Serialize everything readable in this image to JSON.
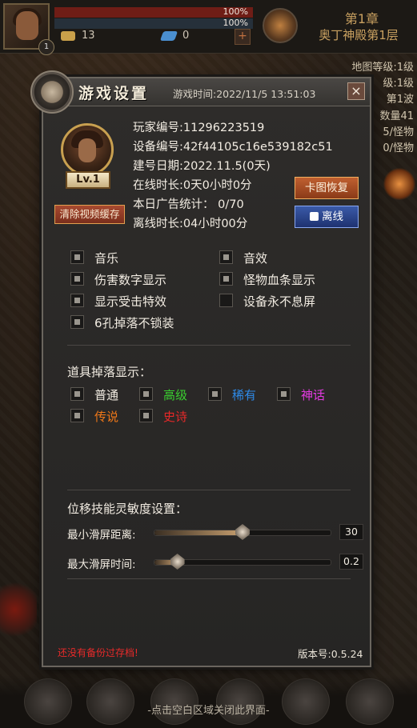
{
  "hud": {
    "hp_percent": "100%",
    "mp_percent": "100%",
    "gold": "13",
    "gems": "0",
    "player_level_badge": "1",
    "chapter": "第1章",
    "stage": "奥丁神殿第1层",
    "side_info": [
      "地图等级:1级",
      "级:1级",
      "第1波",
      "数量41",
      "5/怪物",
      "0/怪物"
    ],
    "close_hint": "-点击空白区域关闭此界面-"
  },
  "dialog": {
    "title": "游戏设置",
    "game_time": "游戏时间:2022/11/5 13:51:03",
    "close_icon": "×",
    "avatar_level": "Lv.1",
    "clear_cache_button": "清除视频缓存",
    "info": {
      "player_id": "玩家编号:11296223519",
      "device_id": "设备编号:42f44105c16e539182c51",
      "created": "建号日期:2022.11.5(0天)",
      "online_time": "在线时长:0天0小时0分",
      "ad_stats": "本日广告统计： 0/70",
      "offline_time": "离线时长:04小时00分"
    },
    "restore_button": "卡图恢复",
    "offline_button": "离线",
    "options": [
      {
        "label": "音乐",
        "checked": true
      },
      {
        "label": "音效",
        "checked": true
      },
      {
        "label": "伤害数字显示",
        "checked": true
      },
      {
        "label": "怪物血条显示",
        "checked": true
      },
      {
        "label": "显示受击特效",
        "checked": true
      },
      {
        "label": "设备永不息屏",
        "checked": false
      },
      {
        "label": "6孔掉落不锁装",
        "checked": true
      }
    ],
    "drop_section_title": "道具掉落显示：",
    "drop_filters": [
      {
        "label": "普通",
        "checked": true,
        "color": "#f2ece2"
      },
      {
        "label": "高级",
        "checked": true,
        "color": "#3ad030"
      },
      {
        "label": "稀有",
        "checked": true,
        "color": "#2e8ae8"
      },
      {
        "label": "神话",
        "checked": true,
        "color": "#e23ae0"
      },
      {
        "label": "传说",
        "checked": true,
        "color": "#f07818"
      },
      {
        "label": "史诗",
        "checked": true,
        "color": "#e82828"
      }
    ],
    "sensitivity_title": "位移技能灵敏度设置：",
    "sliders": [
      {
        "label": "最小滑屏距离:",
        "value": "30",
        "fraction": 0.5
      },
      {
        "label": "最大滑屏时间:",
        "value": "0.2",
        "fraction": 0.13
      }
    ],
    "warning": "还没有备份过存档!",
    "version": "版本号:0.5.24"
  }
}
